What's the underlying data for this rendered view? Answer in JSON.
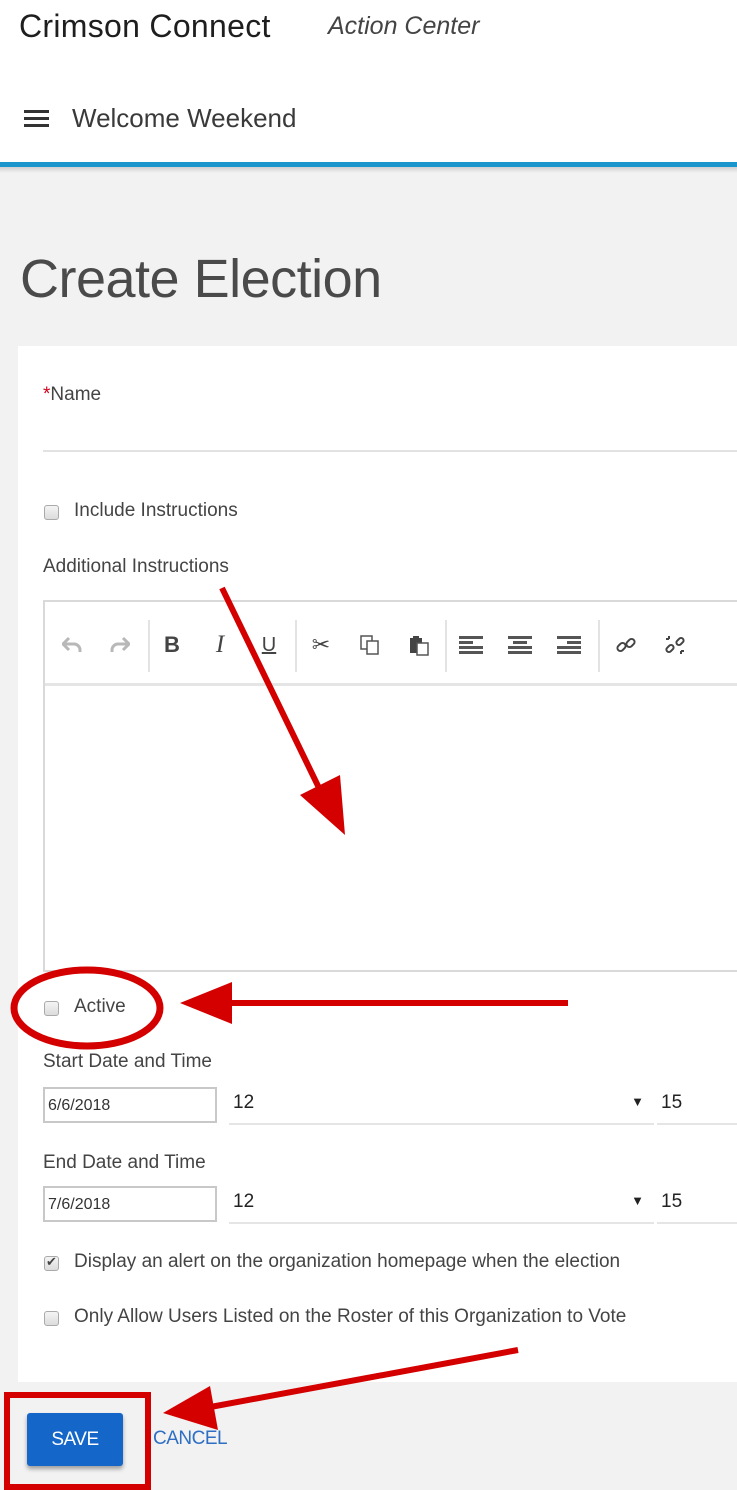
{
  "header": {
    "app_title": "Crimson Connect",
    "subtitle": "Action Center",
    "menu_icon": "hamburger-menu-icon",
    "organization": "Welcome Weekend",
    "accent_color": "#1a96cc"
  },
  "page": {
    "title": "Create Election"
  },
  "form": {
    "name": {
      "required_marker": "*",
      "label": "Name",
      "value": ""
    },
    "include_instructions": {
      "label": "Include Instructions",
      "checked": false
    },
    "additional_instructions": {
      "label": "Additional Instructions",
      "toolbar": [
        {
          "name": "undo",
          "icon": "undo-icon",
          "glyph": "↶",
          "disabled": true
        },
        {
          "name": "redo",
          "icon": "redo-icon",
          "glyph": "↷",
          "disabled": true
        },
        {
          "name": "bold",
          "icon": "bold-icon",
          "glyph": "B"
        },
        {
          "name": "italic",
          "icon": "italic-icon",
          "glyph": "I"
        },
        {
          "name": "underline",
          "icon": "underline-icon",
          "glyph": "U"
        },
        {
          "name": "cut",
          "icon": "scissors-icon",
          "glyph": "✂"
        },
        {
          "name": "copy",
          "icon": "copy-icon",
          "glyph": "⧉"
        },
        {
          "name": "paste",
          "icon": "paste-icon",
          "glyph": "📋"
        },
        {
          "name": "align-left",
          "icon": "align-left-icon",
          "glyph": "☰"
        },
        {
          "name": "align-center",
          "icon": "align-center-icon",
          "glyph": "☰"
        },
        {
          "name": "align-right",
          "icon": "align-right-icon",
          "glyph": "☰"
        },
        {
          "name": "link",
          "icon": "link-icon",
          "glyph": "🔗"
        },
        {
          "name": "unlink",
          "icon": "unlink-icon",
          "glyph": "⛓"
        }
      ],
      "value": ""
    },
    "active": {
      "label": "Active",
      "checked": false
    },
    "start": {
      "label": "Start Date and Time",
      "date": "6/6/2018",
      "hour": "12",
      "minute": "15"
    },
    "end": {
      "label": "End Date and Time",
      "date": "7/6/2018",
      "hour": "12",
      "minute": "15"
    },
    "display_alert": {
      "label": "Display an alert on the organization homepage when the election",
      "checked": true
    },
    "roster_only": {
      "label": "Only Allow Users Listed on the Roster of this Organization to Vote",
      "checked": false
    }
  },
  "actions": {
    "save_label": "SAVE",
    "cancel_label": "CANCEL",
    "primary_color": "#1467c9"
  },
  "annotations": {
    "color": "#d40000"
  }
}
